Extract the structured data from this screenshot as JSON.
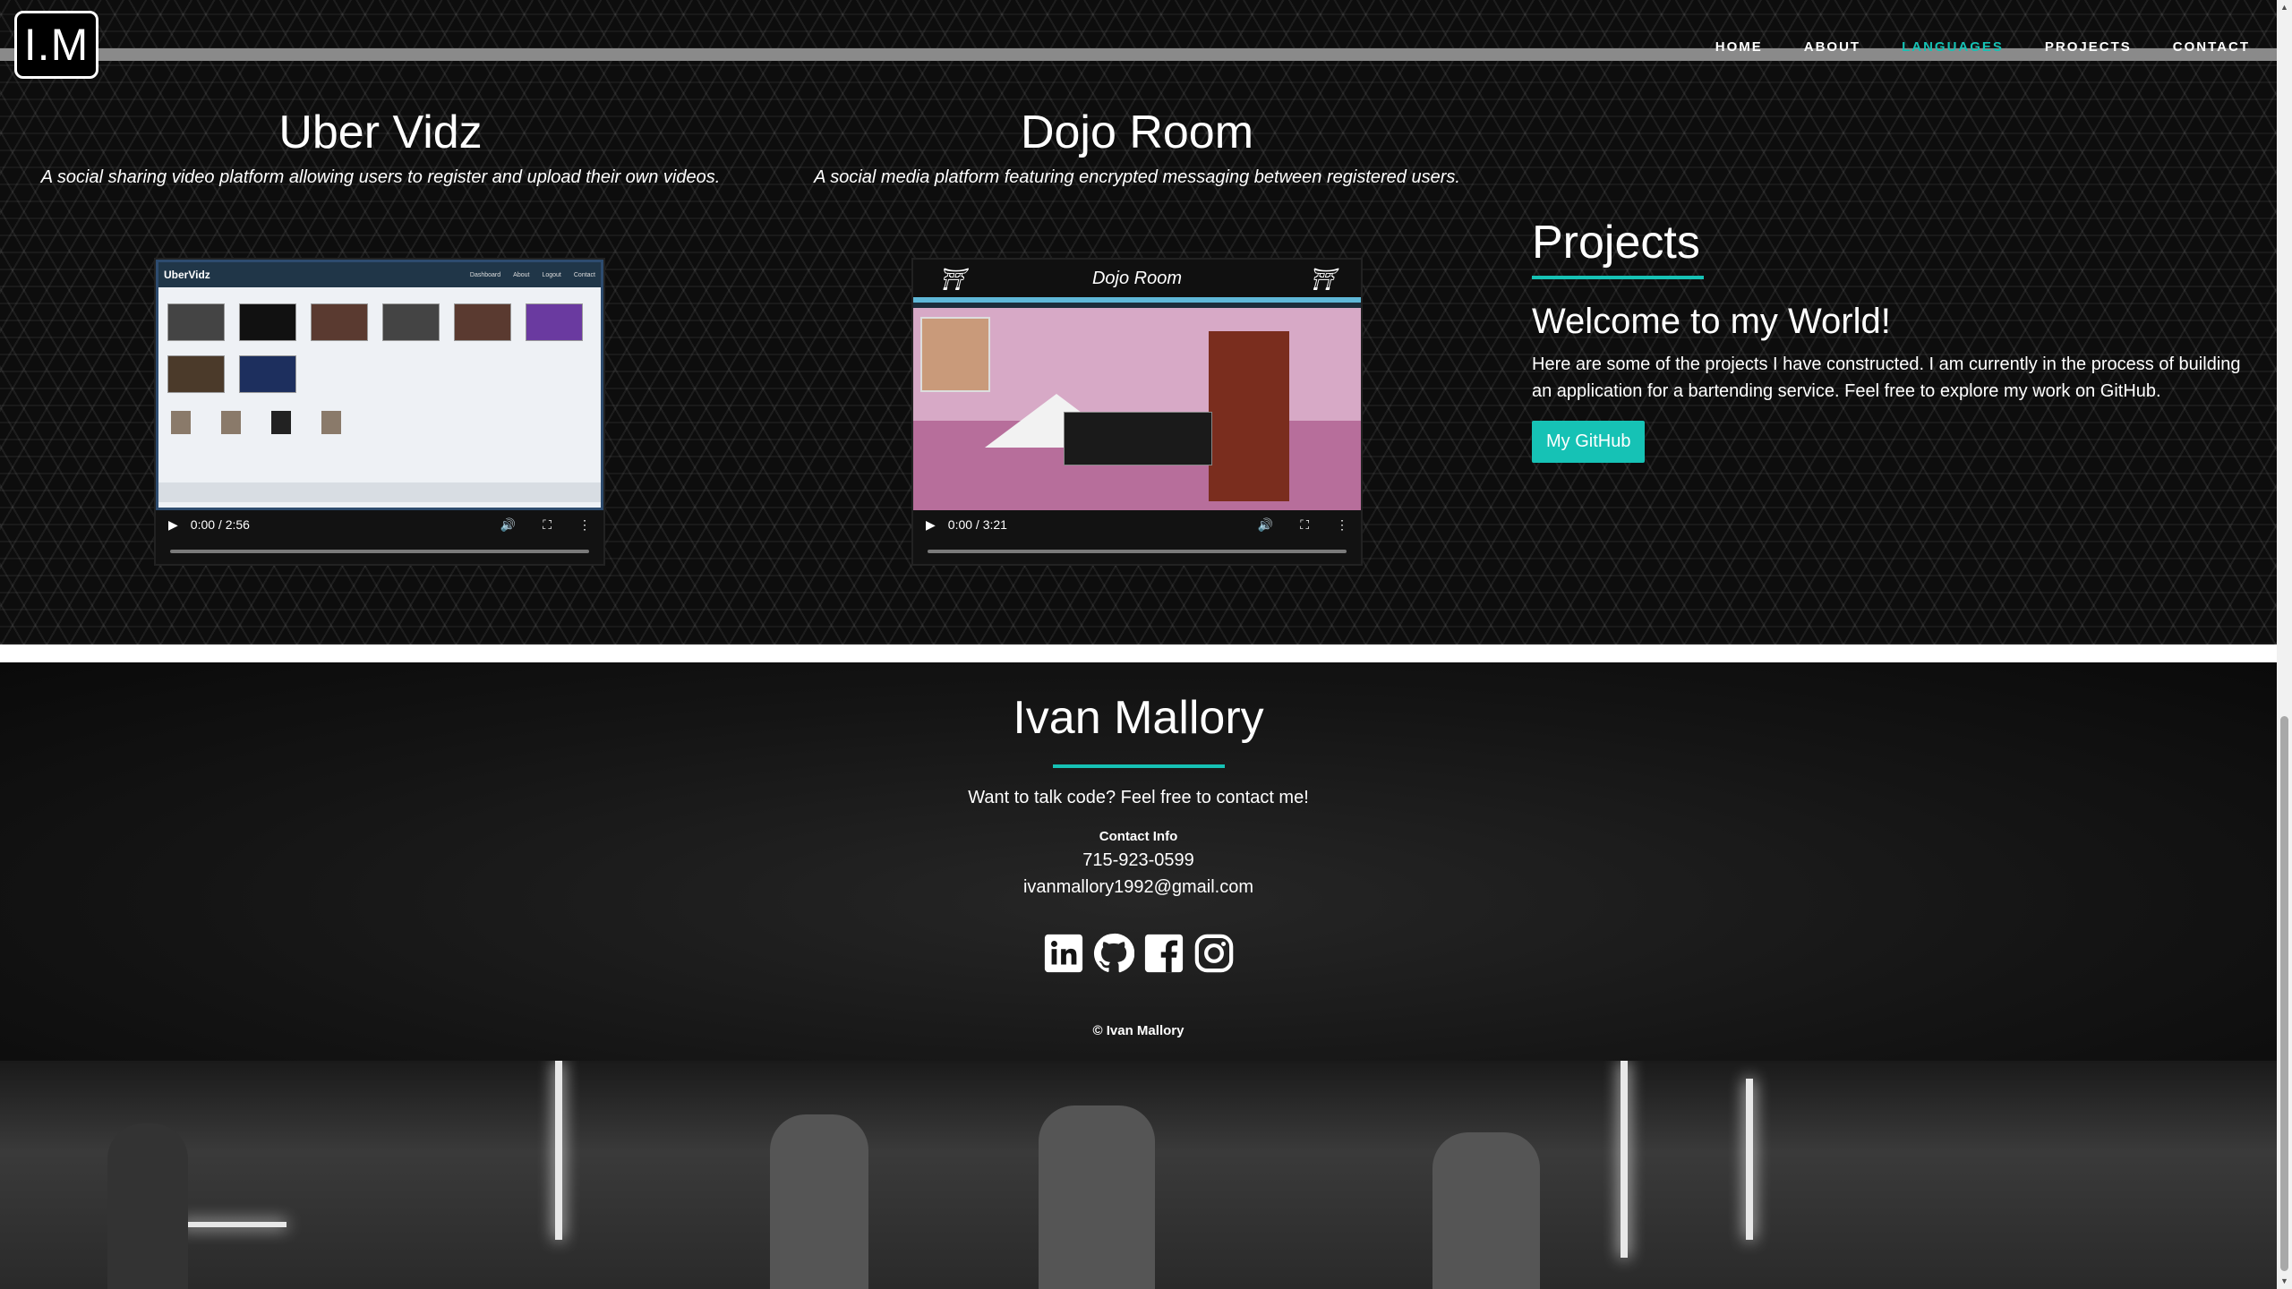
{
  "nav": {
    "logo": "I.M",
    "links": [
      "HOME",
      "ABOUT",
      "LANGUAGES",
      "PROJECTS",
      "CONTACT"
    ],
    "active": "LANGUAGES",
    "accent": "#16c2b5"
  },
  "projects": [
    {
      "title": "Uber Vidz",
      "description": "A social sharing video platform allowing users to register and upload their own videos.",
      "video_time": "0:00 / 2:56",
      "poster_brand": "UberVidz"
    },
    {
      "title": "Dojo Room",
      "description": "A social media platform featuring encrypted messaging between registered users.",
      "video_time": "0:00 / 3:21",
      "poster_brand": "Dojo Room"
    }
  ],
  "sidebar": {
    "heading": "Projects",
    "subheading": "Welcome to my World!",
    "body": "Here are some of the projects I have constructed. I am currently in the process of building an application for a bartending service. Feel free to explore my work on GitHub.",
    "button": "My GitHub"
  },
  "footer": {
    "name": "Ivan Mallory",
    "tagline": "Want to talk code? Feel free to contact me!",
    "contact_heading": "Contact Info",
    "phone": "715-923-0599",
    "email": "ivanmallory1992@gmail.com",
    "socials": [
      "linkedin-icon",
      "github-icon",
      "facebook-icon",
      "instagram-icon"
    ],
    "copyright": "© Ivan Mallory"
  }
}
